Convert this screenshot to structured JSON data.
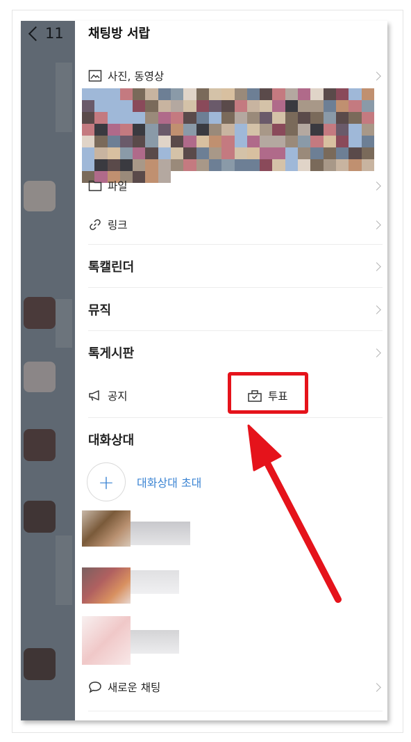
{
  "header": {
    "back_count": "11",
    "title": "채팅방 서랍"
  },
  "sections": {
    "photos": "사진, 동영상",
    "files": "파일",
    "links": "링크",
    "calendar": "톡캘린더",
    "music": "뮤직",
    "board": "톡게시판",
    "notice": "공지",
    "poll": "투표"
  },
  "members": {
    "heading": "대화상대",
    "invite_label": "대화상대 초대"
  },
  "footer": {
    "new_chat": "새로운 채팅"
  },
  "icons": [
    "chevron-left-icon",
    "image-icon",
    "folder-icon",
    "link-icon",
    "megaphone-icon",
    "poll-icon",
    "plus-icon",
    "speech-bubble-icon",
    "chevron-right-icon"
  ],
  "colors": {
    "accent_blue": "#3b84d3",
    "highlight_red": "#e5131b",
    "dim_background": "#5f6872"
  }
}
